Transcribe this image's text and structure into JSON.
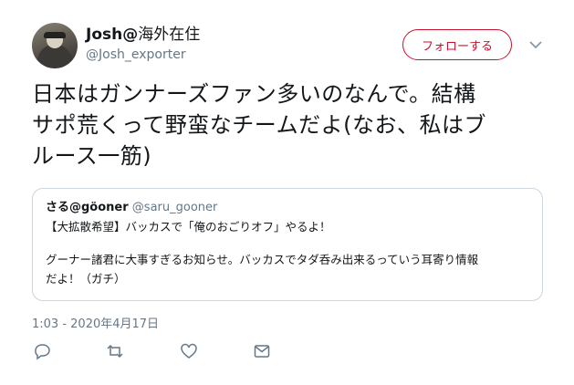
{
  "author": {
    "name": "Josh@",
    "location": "海外在住",
    "handle": "@Josh_exporter"
  },
  "follow_button": {
    "label": "フォローする"
  },
  "tweet": {
    "lines": [
      "日本はガンナーズファン多いのなんで。結構",
      "サポ荒くって野蛮なチームだよ(なお、私はブ",
      "ルース一筋)"
    ]
  },
  "quoted_tweet": {
    "name": "さる@göoner",
    "handle": "@saru_gooner",
    "lines": [
      "【大拡散希望】バッカスで「俺のおごりオフ」やるよ！",
      "",
      "グーナー諸君に大事すぎるお知らせ。バッカスでタダ呑み出来るっていう耳寄り情報",
      "だよ！（ガチ）"
    ]
  },
  "timestamp": "1:03 - 2020年4月17日",
  "colors": {
    "accent": "#c8102e",
    "muted": "#657786",
    "border": "#ccd6dd"
  },
  "icons": [
    "reply-icon",
    "retweet-icon",
    "like-icon",
    "message-icon",
    "chevron-down-icon"
  ]
}
